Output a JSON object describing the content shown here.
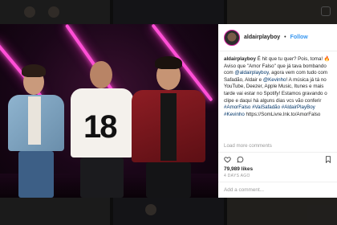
{
  "post": {
    "username": "aldairplayboy",
    "separator": "•",
    "follow_label": "Follow",
    "caption": {
      "user": "aldairplayboy",
      "text_1": " É hit que tu quer? Pois, toma! 🔥 Aviso que \"Amor Falso\" que já tava bombando com ",
      "mention_1": "@aldairplayboy",
      "text_2": ", agora vem com tudo com Safadão, Aldair e ",
      "mention_2": "@Kevinho",
      "text_3": "! A música já tá no YouTube, Deezer, Apple Music, Itunes e mais tarde vai estar no Spotify! Estamos gravando o clipe e daqui há alguns dias vcs vão conferir ",
      "tags": "#AmorFalso #VaiSafadão #AldairPlayBoy #Kevinho",
      "text_4": " https://SomLivre.lnk.to/AmorFalso"
    },
    "load_more": "Load more comments",
    "likes": "79,989 likes",
    "date": "4 DAYS AGO",
    "comment_placeholder": "Add a comment...",
    "photo_number": "18"
  },
  "icons": {
    "like": "heart-icon",
    "comment": "comment-icon",
    "save": "bookmark-icon"
  },
  "colors": {
    "accent": "#3897f0",
    "neon": "#ff4fd6"
  }
}
